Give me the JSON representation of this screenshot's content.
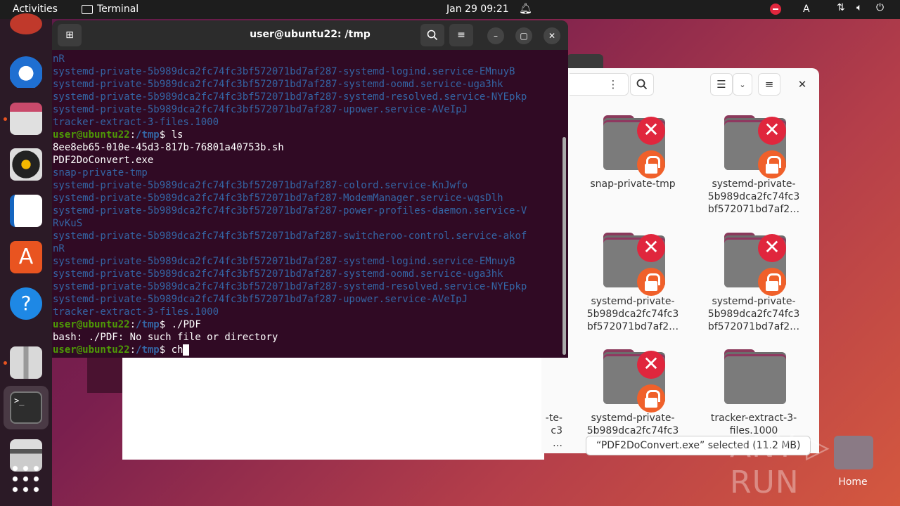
{
  "topbar": {
    "activities": "Activities",
    "app_name": "Terminal",
    "clock": "Jan 29  09:21",
    "keyboard": "A"
  },
  "dock": {
    "items": [
      "ubuntu-circle-icon",
      "thunderbird-icon",
      "files-icon",
      "rhythmbox-icon",
      "libreoffice-writer-icon",
      "app-center-icon",
      "help-icon",
      "archive-icon",
      "terminal-icon",
      "drive-icon",
      "show-apps-icon"
    ]
  },
  "terminal": {
    "title": "user@ubuntu22: /tmp",
    "lines": [
      {
        "t": "nR",
        "c": "dir"
      },
      {
        "t": "systemd-private-5b989dca2fc74fc3bf572071bd7af287-systemd-logind.service-EMnuyB",
        "c": "dir"
      },
      {
        "t": "systemd-private-5b989dca2fc74fc3bf572071bd7af287-systemd-oomd.service-uga3hk",
        "c": "dir"
      },
      {
        "t": "systemd-private-5b989dca2fc74fc3bf572071bd7af287-systemd-resolved.service-NYEpkp",
        "c": "dir"
      },
      {
        "t": "systemd-private-5b989dca2fc74fc3bf572071bd7af287-upower.service-AVeIpJ",
        "c": "dir"
      },
      {
        "t": "tracker-extract-3-files.1000",
        "c": "dir"
      },
      {
        "prompt": true,
        "cmd": " ls"
      },
      {
        "t": "8ee8eb65-010e-45d3-817b-76801a40753b.sh",
        "c": "plain"
      },
      {
        "t": "PDF2DoConvert.exe",
        "c": "plain"
      },
      {
        "t": "snap-private-tmp",
        "c": "dir"
      },
      {
        "t": "systemd-private-5b989dca2fc74fc3bf572071bd7af287-colord.service-KnJwfo",
        "c": "dir"
      },
      {
        "t": "systemd-private-5b989dca2fc74fc3bf572071bd7af287-ModemManager.service-wqsDlh",
        "c": "dir"
      },
      {
        "t": "systemd-private-5b989dca2fc74fc3bf572071bd7af287-power-profiles-daemon.service-V",
        "c": "dir"
      },
      {
        "t": "RvKuS",
        "c": "dir"
      },
      {
        "t": "systemd-private-5b989dca2fc74fc3bf572071bd7af287-switcheroo-control.service-akof",
        "c": "dir"
      },
      {
        "t": "nR",
        "c": "dir"
      },
      {
        "t": "systemd-private-5b989dca2fc74fc3bf572071bd7af287-systemd-logind.service-EMnuyB",
        "c": "dir"
      },
      {
        "t": "systemd-private-5b989dca2fc74fc3bf572071bd7af287-systemd-oomd.service-uga3hk",
        "c": "dir"
      },
      {
        "t": "systemd-private-5b989dca2fc74fc3bf572071bd7af287-systemd-resolved.service-NYEpkp",
        "c": "dir"
      },
      {
        "t": "systemd-private-5b989dca2fc74fc3bf572071bd7af287-upower.service-AVeIpJ",
        "c": "dir"
      },
      {
        "t": "tracker-extract-3-files.1000",
        "c": "dir"
      },
      {
        "prompt": true,
        "cmd": " ./PDF"
      },
      {
        "t": "bash: ./PDF: No such file or directory",
        "c": "plain"
      },
      {
        "prompt": true,
        "cmd": " ch",
        "cursor": true
      }
    ],
    "prompt_user": "user@ubuntu22",
    "prompt_sep": ":",
    "prompt_path": "/tmp",
    "prompt_end": "$"
  },
  "files": {
    "items": [
      {
        "label": [
          "snap-private-tmp"
        ],
        "x": true,
        "lock": true
      },
      {
        "label": [
          "systemd-private-",
          "5b989dca2fc74fc3",
          "bf572071bd7af2…"
        ],
        "x": true,
        "lock": true
      },
      {
        "label": [
          "systemd-private-",
          "5b989dca2fc74fc3",
          "bf572071bd7af2…"
        ],
        "x": true,
        "lock": true
      },
      {
        "label": [
          "systemd-private-",
          "5b989dca2fc74fc3",
          "bf572071bd7af2…"
        ],
        "x": true,
        "lock": true
      },
      {
        "label": [
          "systemd-private-",
          "5b989dca2fc74fc3"
        ],
        "x": true,
        "lock": true
      },
      {
        "label": [
          "tracker-extract-3-",
          "files.1000"
        ],
        "x": false,
        "lock": false
      }
    ],
    "partial_label": [
      "-te-",
      "c3",
      "…"
    ],
    "status": "“PDF2DoConvert.exe” selected (11.2 MB)"
  },
  "desktop": {
    "home_label": "Home",
    "watermark": "ANY ▷ RUN"
  }
}
